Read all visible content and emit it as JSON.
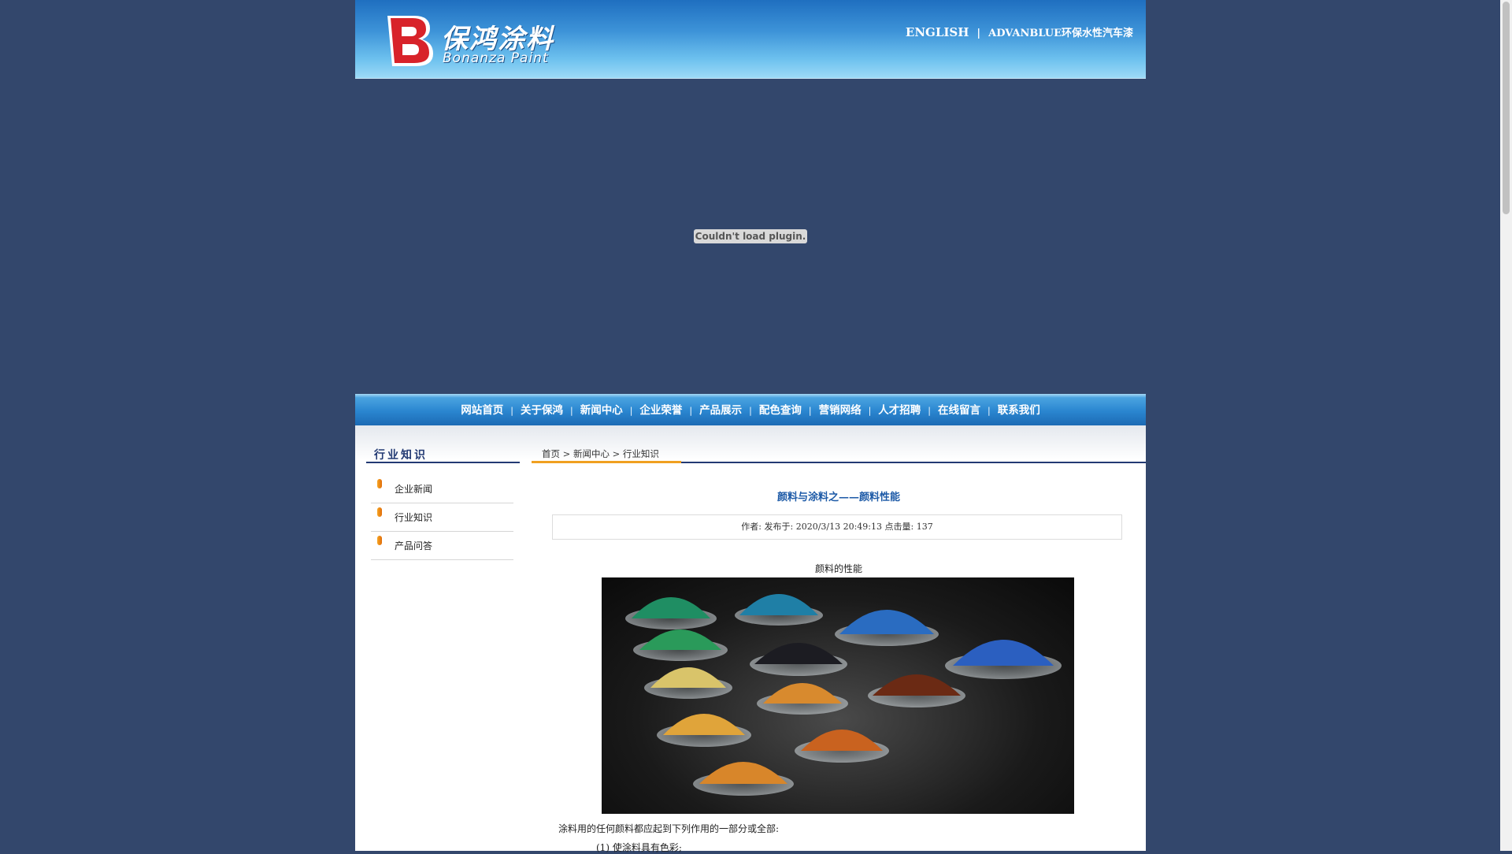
{
  "header": {
    "logo_cn": "保鸿涂料",
    "logo_en": "Bonanza Paint",
    "logo_letter": "B",
    "english_link": "ENGLISH",
    "separator": "|",
    "advanblue_link": "ADVANBLUE环保水性汽车漆"
  },
  "plugin": {
    "message": "Couldn't load plugin."
  },
  "nav": {
    "items": [
      "网站首页",
      "关于保鸿",
      "新闻中心",
      "企业荣誉",
      "产品展示",
      "配色查询",
      "营销网络",
      "人才招聘",
      "在线留言",
      "联系我们"
    ],
    "separator": "|"
  },
  "sidebar": {
    "title": "行业知识",
    "items": [
      {
        "label": "企业新闻"
      },
      {
        "label": "行业知识"
      },
      {
        "label": "产品问答"
      }
    ]
  },
  "breadcrumb": "首页 > 新闻中心 > 行业知识",
  "article": {
    "title": "颜料与涂料之——颜料性能",
    "meta": "作者:   发布于: 2020/3/13 20:49:13 点击量: 137",
    "image_caption": "颜料的性能",
    "paragraph1": "涂料用的任何颜料都应起到下列作用的一部分或全部:",
    "paragraph2": "(1) 使涂料具有色彩;"
  },
  "colors": {
    "page_bg": "#33476c",
    "nav_blue": "#2a86d0",
    "title_blue": "#1d5aa7",
    "accent_orange": "#f0a020",
    "dark_navy": "#233a73",
    "logo_red": "#d8232a"
  }
}
